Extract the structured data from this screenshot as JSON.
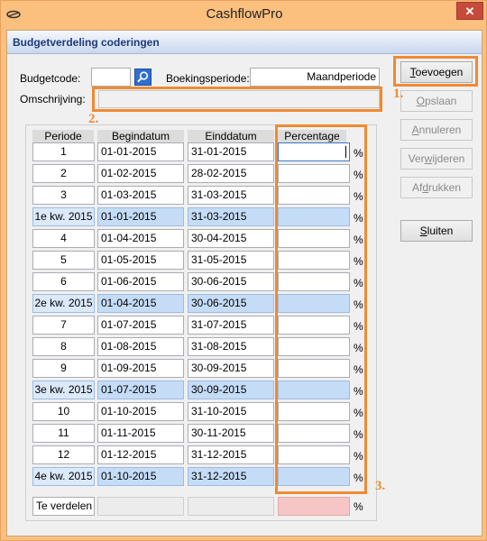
{
  "window": {
    "title": "CashflowPro",
    "close_label": "✕"
  },
  "header": {
    "title": "Budgetverdeling coderingen"
  },
  "form": {
    "budgetcode_label": "Budgetcode:",
    "budgetcode_value": "",
    "boekingsperiode_label": "Boekingsperiode:",
    "boekingsperiode_value": "Maandperiode",
    "omschrijving_label": "Omschrijving:",
    "omschrijving_value": ""
  },
  "table": {
    "columns": [
      "Periode",
      "Begindatum",
      "Einddatum",
      "Percentage"
    ],
    "percent_sign": "%",
    "rows": [
      {
        "period": "1",
        "start": "01-01-2015",
        "end": "31-01-2015",
        "pct": "",
        "quarter": false
      },
      {
        "period": "2",
        "start": "01-02-2015",
        "end": "28-02-2015",
        "pct": "",
        "quarter": false
      },
      {
        "period": "3",
        "start": "01-03-2015",
        "end": "31-03-2015",
        "pct": "",
        "quarter": false
      },
      {
        "period": "1e kw. 2015",
        "start": "01-01-2015",
        "end": "31-03-2015",
        "pct": "",
        "quarter": true
      },
      {
        "period": "4",
        "start": "01-04-2015",
        "end": "30-04-2015",
        "pct": "",
        "quarter": false
      },
      {
        "period": "5",
        "start": "01-05-2015",
        "end": "31-05-2015",
        "pct": "",
        "quarter": false
      },
      {
        "period": "6",
        "start": "01-06-2015",
        "end": "30-06-2015",
        "pct": "",
        "quarter": false
      },
      {
        "period": "2e kw. 2015",
        "start": "01-04-2015",
        "end": "30-06-2015",
        "pct": "",
        "quarter": true
      },
      {
        "period": "7",
        "start": "01-07-2015",
        "end": "31-07-2015",
        "pct": "",
        "quarter": false
      },
      {
        "period": "8",
        "start": "01-08-2015",
        "end": "31-08-2015",
        "pct": "",
        "quarter": false
      },
      {
        "period": "9",
        "start": "01-09-2015",
        "end": "30-09-2015",
        "pct": "",
        "quarter": false
      },
      {
        "period": "3e kw. 2015",
        "start": "01-07-2015",
        "end": "30-09-2015",
        "pct": "",
        "quarter": true
      },
      {
        "period": "10",
        "start": "01-10-2015",
        "end": "31-10-2015",
        "pct": "",
        "quarter": false
      },
      {
        "period": "11",
        "start": "01-11-2015",
        "end": "30-11-2015",
        "pct": "",
        "quarter": false
      },
      {
        "period": "12",
        "start": "01-12-2015",
        "end": "31-12-2015",
        "pct": "",
        "quarter": false
      },
      {
        "period": "4e kw. 2015",
        "start": "01-10-2015",
        "end": "31-12-2015",
        "pct": "",
        "quarter": true
      }
    ],
    "total_label": "Te verdelen"
  },
  "buttons": {
    "toevoegen": {
      "u": "T",
      "rest": "oevoegen"
    },
    "opslaan": {
      "u": "O",
      "rest": "pslaan"
    },
    "annuleren": {
      "u": "A",
      "rest": "nnuleren"
    },
    "verwijderen": {
      "pre": "Ver",
      "u": "w",
      "rest": "ijderen"
    },
    "afdrukken": {
      "pre": "Af",
      "u": "d",
      "rest": "rukken"
    },
    "sluiten": {
      "u": "S",
      "rest": "luiten"
    }
  },
  "annotations": {
    "marker_1": "1.",
    "marker_2": "2.",
    "marker_3": "3.",
    "color": "#f08a32"
  },
  "icons": {
    "app": "app-logo-icon",
    "search": "search-icon"
  }
}
